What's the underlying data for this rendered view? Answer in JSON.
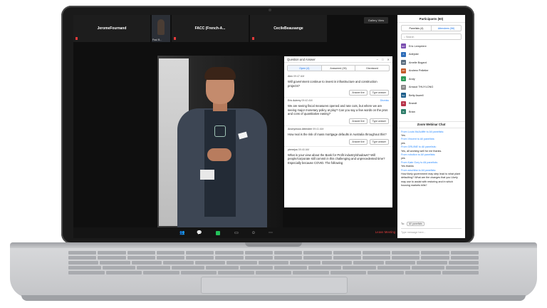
{
  "strip": {
    "tiles": [
      "JeromeFournand",
      "FACC (French-A...",
      "CecileBeausange"
    ],
    "video_tile_label": "Paul B...",
    "gallery_view": "Gallery View"
  },
  "qa": {
    "title": "Question and Answer",
    "tabs": [
      "Open (4)",
      "Answered (26)",
      "Dismissed"
    ],
    "questions": [
      {
        "author": "Alex",
        "time": "09:47 AM",
        "text": "Will government continue to invest in infrastructure and construction projects?",
        "live": "Answer live",
        "type": "Type answer"
      },
      {
        "author": "Eric Aubrey",
        "time": "09:42 AM",
        "dismiss": "Dismiss",
        "text": "We are seeing fiscal measures opened and rate cuts, but where we are seeing major monetary policy at play? Can you say a few words on the pros and cons of quantitative easing?",
        "live": "Answer live",
        "type": "Type answer"
      },
      {
        "author": "Anonymous Attendee",
        "time": "09:41 AM",
        "text": "How real is the risk of mass mortgage defaults in Australia throughout this?",
        "live": "Answer live",
        "type": "Type answer"
      },
      {
        "author": "pierrejos",
        "time": "09:40 AM",
        "text": "What is your view about the Bank for Profit industry/shadows? Will people/corporate still commit in this challenging and unprecedented time? Especially because COVID. The following",
        "live": "",
        "type": ""
      }
    ]
  },
  "toolbar": {
    "icons": [
      "participants-icon",
      "chat-bubble-icon",
      "share-screen-icon",
      "qa-icon",
      "reactions-icon",
      "more-icon"
    ],
    "leave": "Leave Meeting"
  },
  "panel": {
    "title": "Participants (60)",
    "tabs": [
      "Panelists (4)",
      "Attendees (56)"
    ],
    "search": "Search",
    "participants": [
      {
        "initials": "EC",
        "name": "Eric Lempriere",
        "color": "#7b4fb0"
      },
      {
        "initials": "A",
        "name": "Adejoke",
        "color": "#2e6db8"
      },
      {
        "initials": "AB",
        "name": "Amelie Bogard",
        "color": "#5a6c7e"
      },
      {
        "initials": "AP",
        "name": "Andrew Pelletier",
        "color": "#c45a2b"
      },
      {
        "initials": "A",
        "name": "Andy",
        "color": "#2e9a59"
      },
      {
        "initials": "AT",
        "name": "Arnaud THUYLONG",
        "color": "#8a8a8a"
      },
      {
        "initials": "BA",
        "name": "Betty Aswell",
        "color": "#1f5f8b"
      },
      {
        "initials": "B",
        "name": "Brandt",
        "color": "#b8344a"
      },
      {
        "initials": "B",
        "name": "Brian",
        "color": "#2f7d6a"
      }
    ],
    "chat_title": "Zoom Webinar Chat",
    "messages": [
      {
        "from": "From Louis McAuliffe to All panelists:",
        "text": "Yes"
      },
      {
        "from": "From Vincent to All panelists:",
        "text": "yes"
      },
      {
        "from": "From GRUINE to All panelists:",
        "text": "Yes, all working well for me thanks."
      },
      {
        "from": "From rcbolton to All panelists:",
        "text": "yes"
      },
      {
        "from": "From Kate Gory to All panelists:",
        "text": "Yes thanks"
      },
      {
        "from": "From arschiba to All panelists:",
        "text": "How likely government may step lead to what plant defaulting? What are the changes that you Likely may use to assist with restoring and in which housing markets bills?"
      }
    ],
    "to_label": "To:",
    "to_value": "All panelists",
    "type_placeholder": "Type message here..."
  }
}
